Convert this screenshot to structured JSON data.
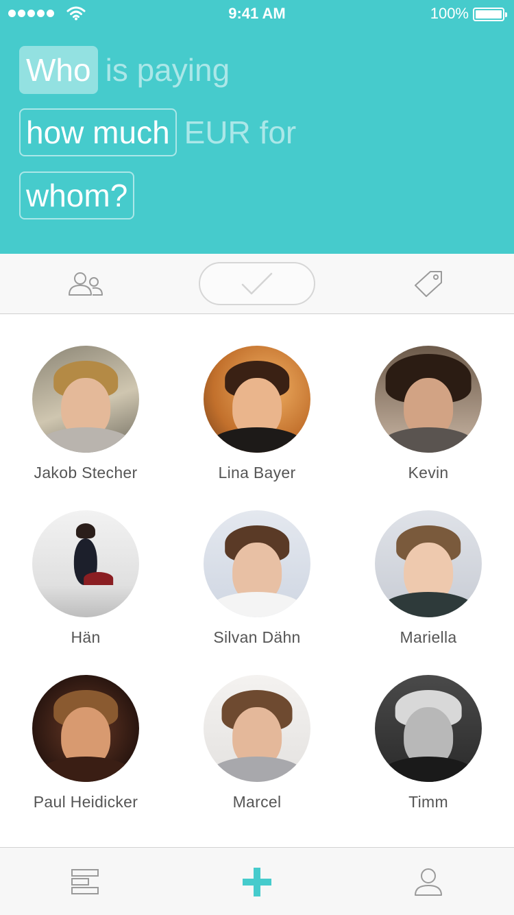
{
  "status_bar": {
    "time": "9:41 AM",
    "battery": "100%",
    "signal_icon": "signal-dots-icon",
    "wifi_icon": "wifi-icon",
    "battery_icon": "battery-icon"
  },
  "sentence": {
    "who": "Who",
    "is_paying": "is paying",
    "how_much": "how much",
    "eur_for": "EUR for",
    "whom": "whom?"
  },
  "steps": {
    "people_icon": "people-icon",
    "confirm_icon": "checkmark-icon",
    "tag_icon": "tag-icon"
  },
  "people": [
    {
      "name": "Jakob Stecher"
    },
    {
      "name": "Lina Bayer"
    },
    {
      "name": "Kevin"
    },
    {
      "name": "Hän"
    },
    {
      "name": "Silvan Dähn"
    },
    {
      "name": "Mariella"
    },
    {
      "name": "Paul Heidicker"
    },
    {
      "name": "Marcel"
    },
    {
      "name": "Timm"
    }
  ],
  "tab_bar": {
    "feed_icon": "list-icon",
    "add_icon": "plus-icon",
    "profile_icon": "profile-icon"
  },
  "colors": {
    "accent": "#46cbcc",
    "text": "#555555",
    "icon_gray": "#9a9a9a"
  }
}
